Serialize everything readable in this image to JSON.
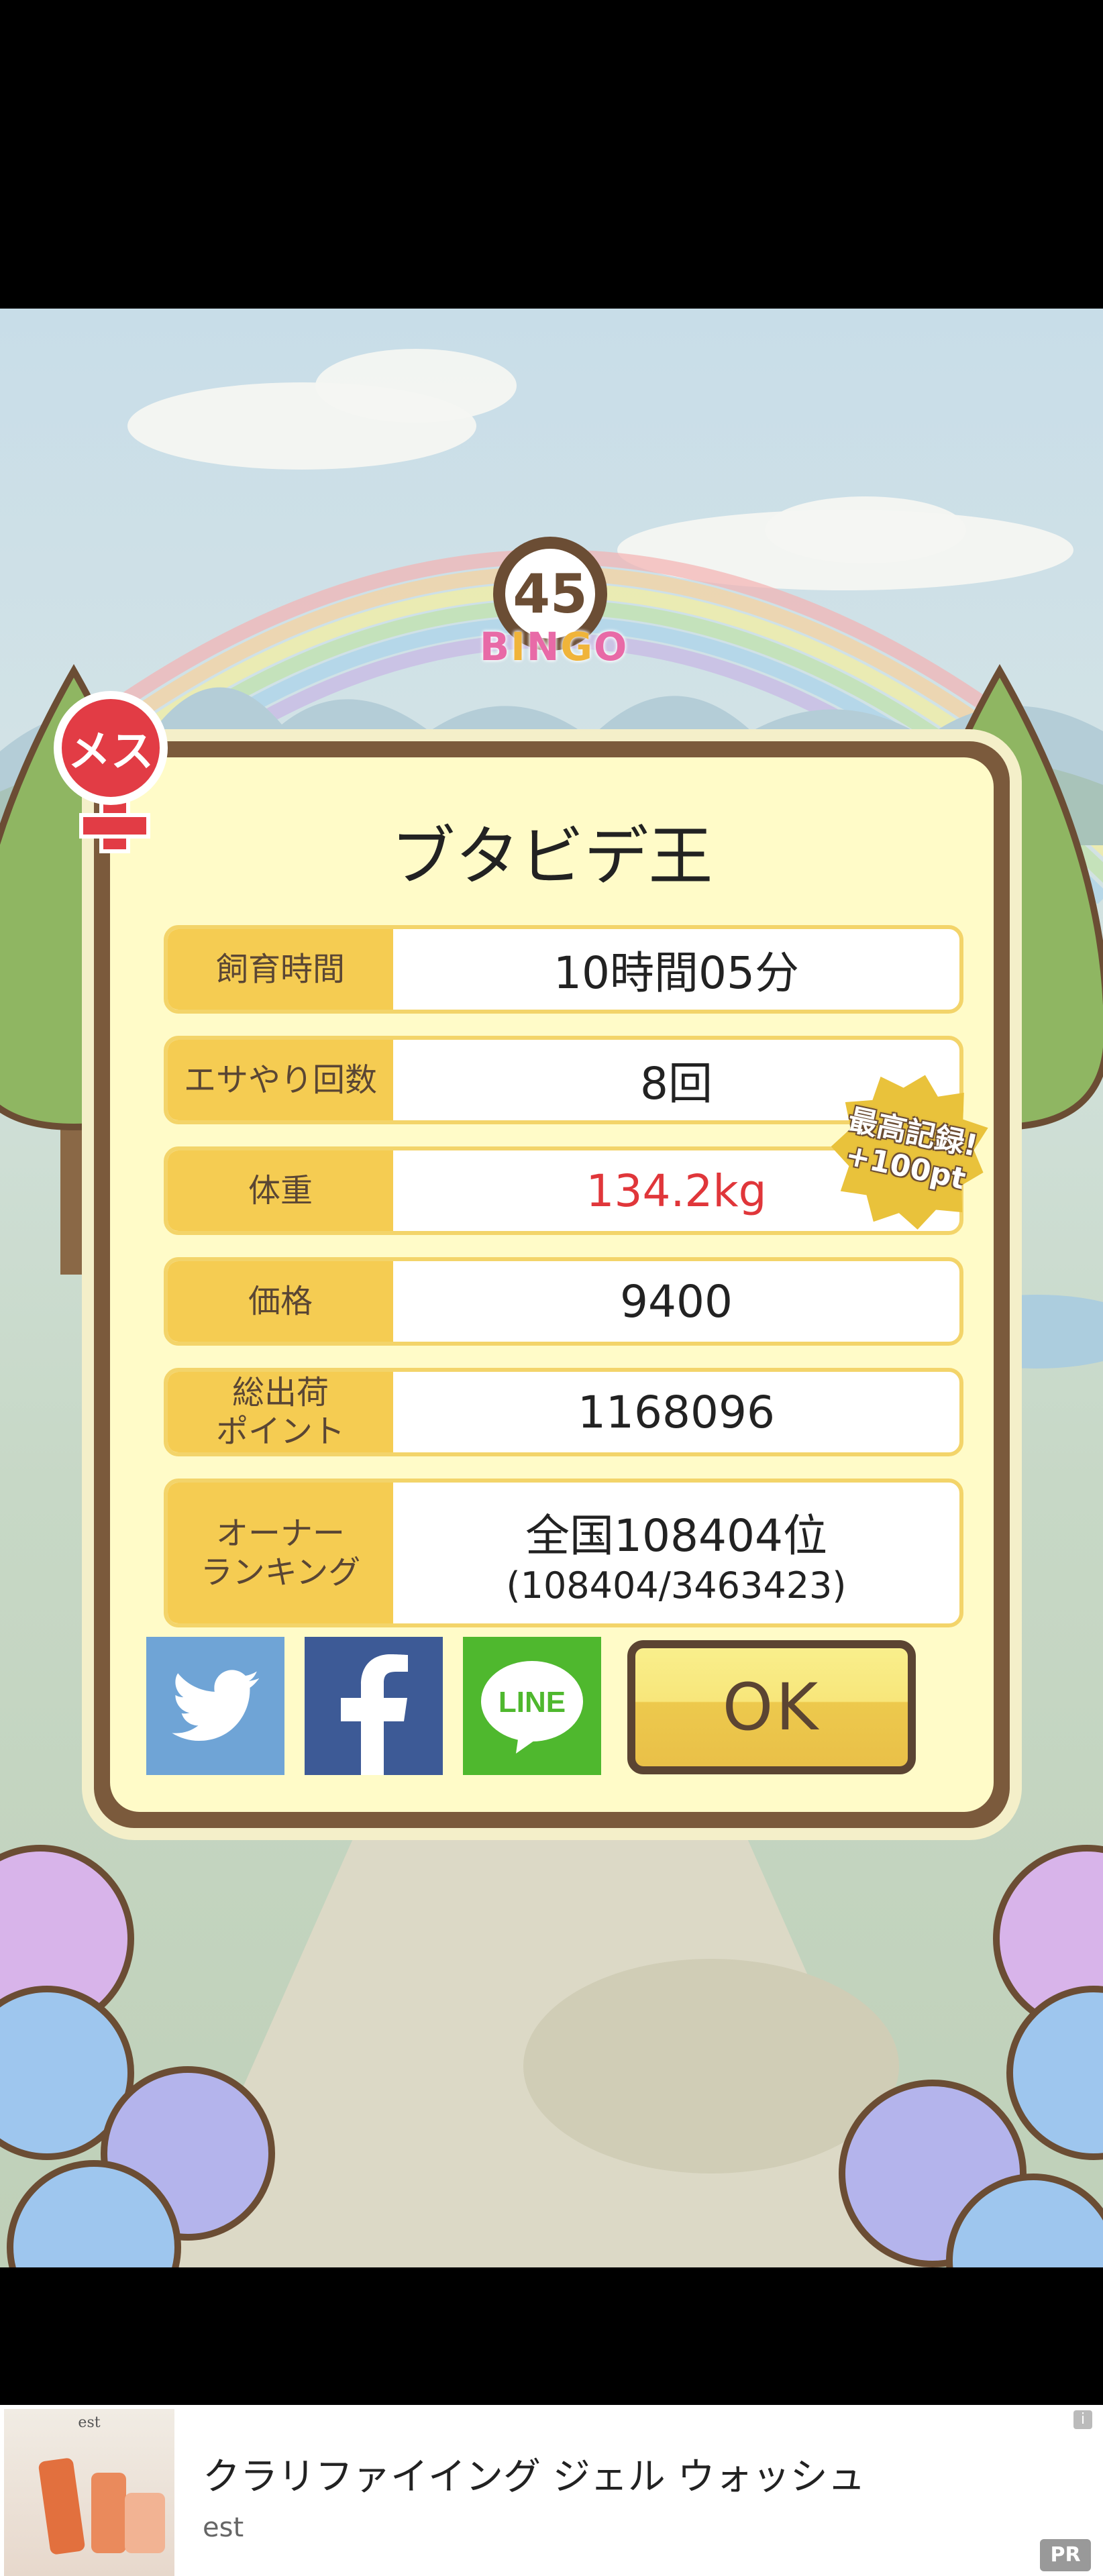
{
  "bingo": {
    "number": "45",
    "letters": [
      {
        "ch": "B",
        "color": "#e86aa7"
      },
      {
        "ch": "I",
        "color": "#f0b43a"
      },
      {
        "ch": "N",
        "color": "#e86aa7"
      },
      {
        "ch": "G",
        "color": "#f0b43a"
      },
      {
        "ch": "O",
        "color": "#e86aa7"
      }
    ]
  },
  "sex_badge": {
    "label": "メス",
    "icon": "female-icon"
  },
  "panel": {
    "title": "ブタビデ王",
    "stats": [
      {
        "label": "飼育時間",
        "value": "10時間05分"
      },
      {
        "label": "エサやり回数",
        "value": "8回"
      },
      {
        "label": "体重",
        "value": "134.2kg",
        "highlight": "#e0363a"
      },
      {
        "label": "価格",
        "value": "9400"
      },
      {
        "label": "総出荷\nポイント",
        "value": "1168096"
      },
      {
        "label": "オーナー\nランキング",
        "value": "全国108404位",
        "sub": "(108404/3463423)"
      }
    ],
    "record_badge": {
      "line1": "最高記録!",
      "line2": "+100pt"
    }
  },
  "share": {
    "twitter": "twitter-icon",
    "facebook": "facebook-icon",
    "line": {
      "icon": "line-icon",
      "label": "LINE"
    }
  },
  "ok_button": {
    "label": "OK"
  },
  "ad": {
    "title": "クラリファイイング ジェル ウォッシュ",
    "brand": "est",
    "pr": "PR",
    "info": "i",
    "thumbnail": {
      "brand": "est"
    }
  },
  "colors": {
    "panel_border": "#7b5a3c",
    "panel_fill": "#fffbc8",
    "label_fill": "#f5cc52",
    "ok_fill": "#f8e67a"
  }
}
